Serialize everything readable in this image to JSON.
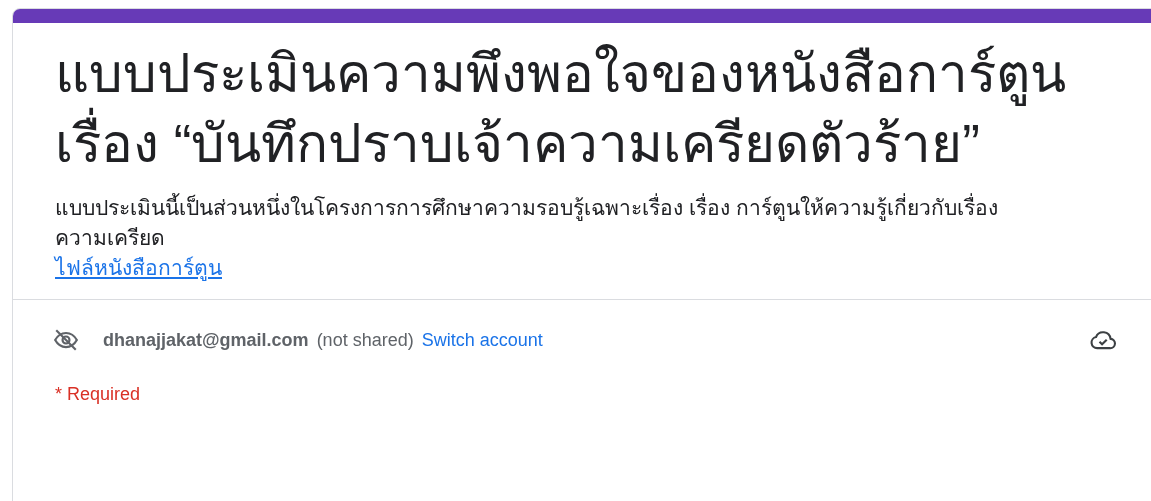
{
  "form": {
    "title": "แบบประเมินความพึงพอใจของหนังสือการ์ตูน เรื่อง “บันทึกปราบเจ้าความเครียดตัวร้าย”",
    "description": "แบบประเมินนี้เป็นส่วนหนึ่งในโครงการการศึกษาความรอบรู้เฉพาะเรื่อง เรื่อง การ์ตูนให้ความรู้เกี่ยวกับเรื่องความเครียด",
    "link": "ไฟล์หนังสือการ์ตูน"
  },
  "account": {
    "email": "dhanajjakat@gmail.com",
    "note": "(not shared)",
    "switch": "Switch account"
  },
  "required_note": "* Required"
}
